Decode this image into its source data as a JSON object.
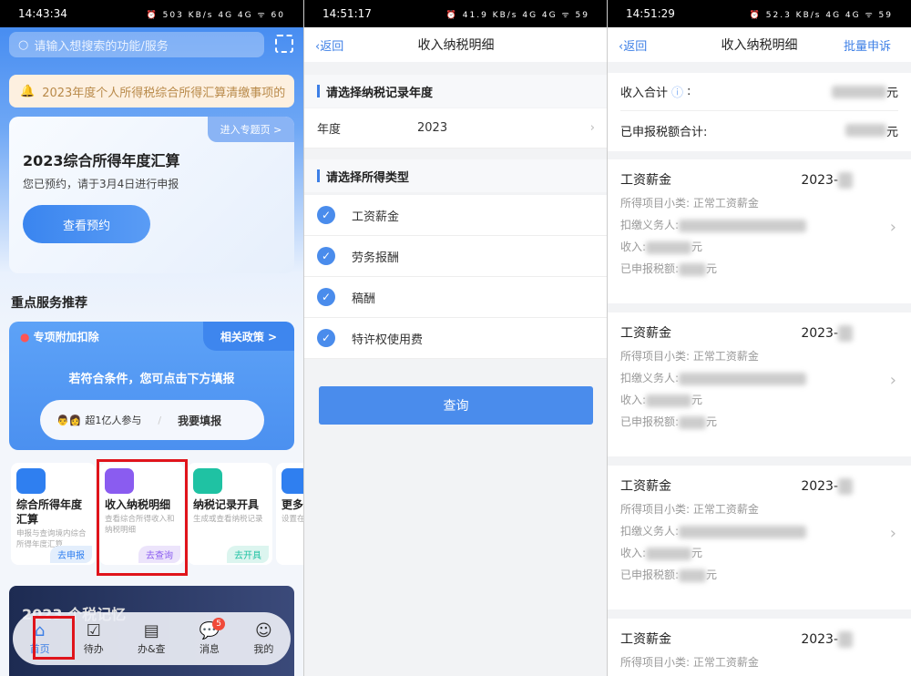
{
  "panel1": {
    "status": {
      "time": "14:43:34",
      "net": "503 KB/s",
      "battery": "60"
    },
    "search_placeholder": "请输入想搜索的功能/服务",
    "notice": "2023年度个人所得税综合所得汇算清缴事项的",
    "card": {
      "tag": "进入专题页 >",
      "title": "2023综合所得年度汇算",
      "subtitle": "您已预约，请于3月4日进行申报",
      "button": "查看预约"
    },
    "section_title": "重点服务推荐",
    "special": {
      "title": "专项附加扣除",
      "policy": "相关政策 >",
      "hint": "若符合条件，您可点击下方填报",
      "participants": "超1亿人参与",
      "fill": "我要填报"
    },
    "services": [
      {
        "title": "综合所得年度汇算",
        "desc": "申报与查询境内综合所得年度汇算",
        "action": "去申报",
        "color": "#2f7ff0"
      },
      {
        "title": "收入纳税明细",
        "desc": "查看综合所得收入和纳税明细",
        "action": "去查询",
        "color": "#8a5cf0"
      },
      {
        "title": "纳税记录开具",
        "desc": "生成或查看纳税记录",
        "action": "去开具",
        "color": "#1fc2a3"
      },
      {
        "title": "更多功",
        "desc": "设置在用功能",
        "action": "",
        "color": "#2f7ff0"
      }
    ],
    "banner": "2023 个税记忆",
    "tabs": [
      {
        "label": "首页",
        "icon": "home-icon"
      },
      {
        "label": "待办",
        "icon": "calendar-check-icon"
      },
      {
        "label": "办&查",
        "icon": "document-icon"
      },
      {
        "label": "消息",
        "icon": "message-icon",
        "badge": "5"
      },
      {
        "label": "我的",
        "icon": "smile-icon"
      }
    ]
  },
  "panel2": {
    "status": {
      "time": "14:51:17",
      "net": "41.9 KB/s",
      "battery": "59"
    },
    "back": "返回",
    "title": "收入纳税明细",
    "year_header": "请选择纳税记录年度",
    "year_label": "年度",
    "year_value": "2023",
    "type_header": "请选择所得类型",
    "types": [
      "工资薪金",
      "劳务报酬",
      "稿酬",
      "特许权使用费"
    ],
    "query": "查询"
  },
  "panel3": {
    "status": {
      "time": "14:51:29",
      "net": "52.3 KB/s",
      "battery": "59"
    },
    "back": "返回",
    "title": "收入纳税明细",
    "appeal": "批量申诉",
    "income_total": "收入合计",
    "tax_total": "已申报税额合计:",
    "unit": "元",
    "items": [
      {
        "type": "工资薪金",
        "date": "2023-",
        "sub": "所得项目小类: 正常工资薪金",
        "payer": "扣缴义务人:",
        "income": "收入:",
        "tax": "已申报税额:"
      },
      {
        "type": "工资薪金",
        "date": "2023-",
        "sub": "所得项目小类: 正常工资薪金",
        "payer": "扣缴义务人:",
        "income": "收入:",
        "tax": "已申报税额:"
      },
      {
        "type": "工资薪金",
        "date": "2023-",
        "sub": "所得项目小类: 正常工资薪金",
        "payer": "扣缴义务人:",
        "income": "收入:",
        "tax": "已申报税额:"
      },
      {
        "type": "工资薪金",
        "date": "2023-",
        "sub": "所得项目小类: 正常工资薪金",
        "payer": "",
        "income": "",
        "tax": ""
      }
    ]
  }
}
